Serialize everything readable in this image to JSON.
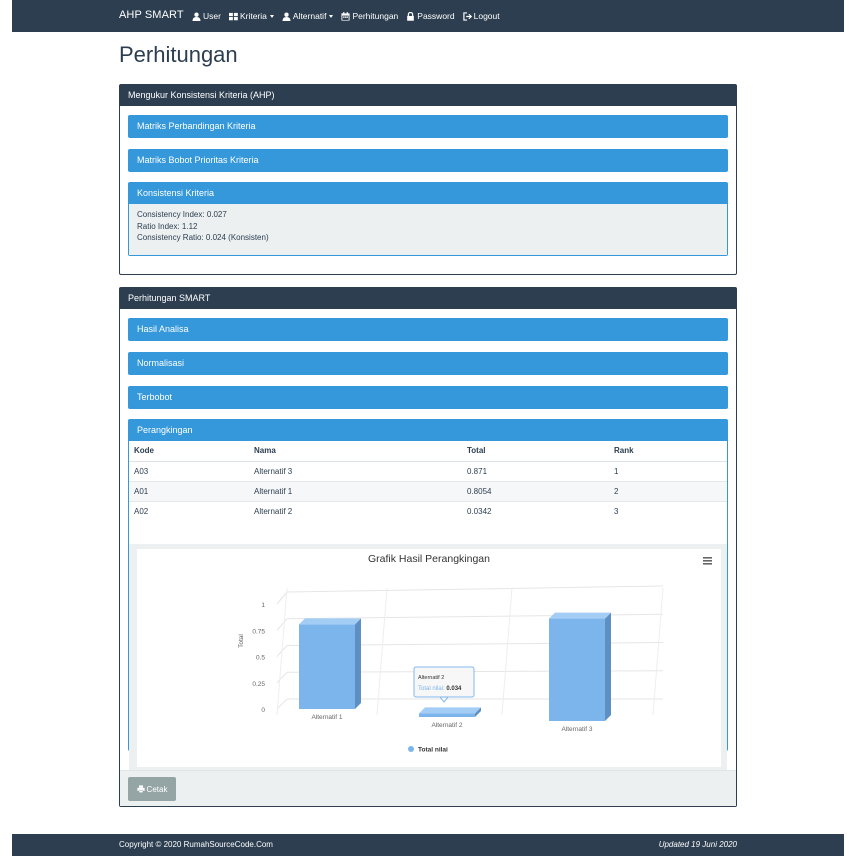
{
  "navbar": {
    "brand": "AHP SMART",
    "items": [
      {
        "label": "User",
        "icon": "user-icon",
        "dropdown": false
      },
      {
        "label": "Kriteria",
        "icon": "grid-icon",
        "dropdown": true
      },
      {
        "label": "Alternatif",
        "icon": "user-icon",
        "dropdown": true
      },
      {
        "label": "Perhitungan",
        "icon": "calendar-icon",
        "dropdown": false
      },
      {
        "label": "Password",
        "icon": "lock-icon",
        "dropdown": false
      },
      {
        "label": "Logout",
        "icon": "logout-icon",
        "dropdown": false
      }
    ]
  },
  "page": {
    "title": "Perhitungan"
  },
  "ahp_panel": {
    "title": "Mengukur Konsistensi Kriteria (AHP)",
    "sections": [
      "Matriks Perbandingan Kriteria",
      "Matriks Bobot Prioritas Kriteria",
      "Konsistensi Kriteria"
    ],
    "consistency": {
      "ci": "Consistency Index: 0.027",
      "ri": "Ratio Index: 1.12",
      "cr": "Consistency Ratio: 0.024 (Konsisten)"
    }
  },
  "smart_panel": {
    "title": "Perhitungan SMART",
    "sections": [
      "Hasil Analisa",
      "Normalisasi",
      "Terbobot",
      "Perangkingan"
    ],
    "table": {
      "headers": [
        "Kode",
        "Nama",
        "Total",
        "Rank"
      ],
      "rows": [
        [
          "A03",
          "Alternatif 3",
          "0.871",
          "1"
        ],
        [
          "A01",
          "Alternatif 1",
          "0.8054",
          "2"
        ],
        [
          "A02",
          "Alternatif 2",
          "0.0342",
          "3"
        ]
      ]
    },
    "print_label": "Cetak"
  },
  "chart_data": {
    "type": "bar",
    "title": "Grafik Hasil Perangkingan",
    "categories": [
      "Alternatif 1",
      "Alternatif 2",
      "Alternatif 3"
    ],
    "series": [
      {
        "name": "Total nilai",
        "values": [
          0.8054,
          0.0342,
          0.871
        ]
      }
    ],
    "ylabel": "Total",
    "xlabel": "",
    "ylim": [
      0,
      1
    ],
    "yticks": [
      "0",
      "0.25",
      "0.5",
      "0.75",
      "1"
    ],
    "color": "#7cb5ec",
    "legend": "bottom-center",
    "tooltip": {
      "category": "Alternatif 2",
      "series": "Total nilai",
      "value": "0.034"
    }
  },
  "footer": {
    "copyright": "Copyright © 2020 RumahSourceCode.Com",
    "updated": "Updated 19 Juni 2020"
  }
}
